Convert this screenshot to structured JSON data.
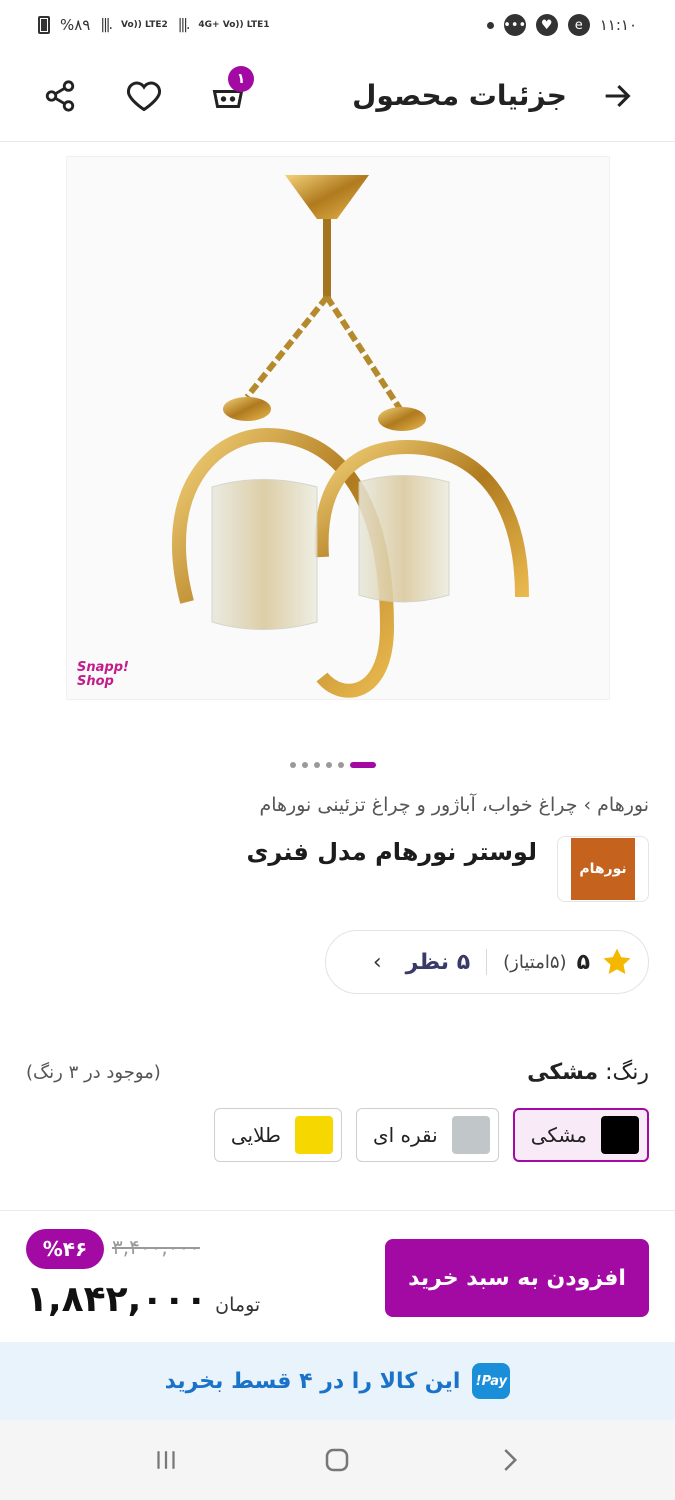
{
  "status_bar": {
    "battery": "%۸۹",
    "net1": "Vo)) LTE2",
    "net2": "4G+ Vo)) LTE1",
    "time": "۱۱:۱۰"
  },
  "header": {
    "title": "جزئیات محصول",
    "cart_count": "۱"
  },
  "image": {
    "watermark_line1": "Snapp!",
    "watermark_line2": "Shop",
    "page_count": 6,
    "active_page": 5
  },
  "product": {
    "breadcrumb": [
      "نورهام",
      "چراغ خواب، آباژور و چراغ تزئینی نورهام"
    ],
    "breadcrumb_sep": "›",
    "title": "لوستر نورهام مدل فنری",
    "brand_logo_text": "نورهام"
  },
  "rating": {
    "score": "۵",
    "count": "(۵امتیاز)",
    "reviews": "۵ نظر",
    "chevron": "›"
  },
  "colors": {
    "label": "رنگ:",
    "selected": "مشکی",
    "availability": "(موجود در ۳ رنگ)",
    "options": [
      {
        "name": "مشکی",
        "hex": "#000000",
        "selected": true
      },
      {
        "name": "نقره ای",
        "hex": "#c1c7c9",
        "selected": false
      },
      {
        "name": "طلایی",
        "hex": "#f7d700",
        "selected": false
      }
    ]
  },
  "purchase": {
    "add_to_cart": "افزودن به سبد خرید",
    "discount": "%۴۶",
    "old_price": "۳,۴۰۰,۰۰۰",
    "price": "۱,۸۴۲,۰۰۰",
    "currency": "تومان"
  },
  "installment": {
    "pay_icon": "Pay!",
    "text": "این کالا را در ۴ قسط بخرید"
  },
  "theme": {
    "accent": "#a30aa3",
    "install_blue": "#1a73c8"
  }
}
